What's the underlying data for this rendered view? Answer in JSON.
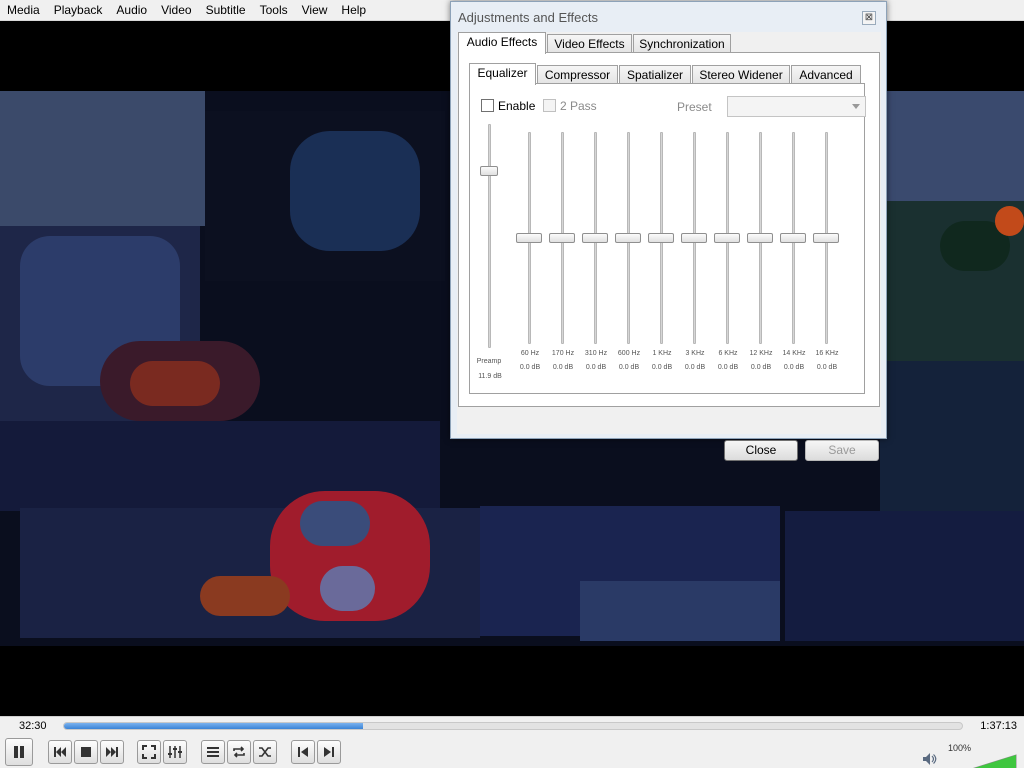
{
  "menubar": {
    "items": [
      "Media",
      "Playback",
      "Audio",
      "Video",
      "Subtitle",
      "Tools",
      "View",
      "Help"
    ]
  },
  "player": {
    "time_elapsed": "32:30",
    "time_total": "1:37:13",
    "progress_fraction": 0.333,
    "volume_label": "100%",
    "volume_fraction": 1.0,
    "accent_color": "#3a83d6"
  },
  "dialog": {
    "title": "Adjustments and Effects",
    "close_glyph": "⊠",
    "top_tabs": [
      "Audio Effects",
      "Video Effects",
      "Synchronization"
    ],
    "active_top_tab": "Audio Effects",
    "sub_tabs": [
      "Equalizer",
      "Compressor",
      "Spatializer",
      "Stereo Widener",
      "Advanced"
    ],
    "active_sub_tab": "Equalizer",
    "enable_label": "Enable",
    "enable_checked": false,
    "twopass_label": "2 Pass",
    "preset_label": "Preset",
    "preset_value": "",
    "preamp": {
      "name": "Preamp",
      "value": "11.9 dB",
      "level_fraction": 0.79
    },
    "bands": [
      {
        "freq": "60 Hz",
        "value": "0.0 dB",
        "level_fraction": 0.5
      },
      {
        "freq": "170 Hz",
        "value": "0.0 dB",
        "level_fraction": 0.5
      },
      {
        "freq": "310 Hz",
        "value": "0.0 dB",
        "level_fraction": 0.5
      },
      {
        "freq": "600 Hz",
        "value": "0.0 dB",
        "level_fraction": 0.5
      },
      {
        "freq": "1 KHz",
        "value": "0.0 dB",
        "level_fraction": 0.5
      },
      {
        "freq": "3 KHz",
        "value": "0.0 dB",
        "level_fraction": 0.5
      },
      {
        "freq": "6 KHz",
        "value": "0.0 dB",
        "level_fraction": 0.5
      },
      {
        "freq": "12 KHz",
        "value": "0.0 dB",
        "level_fraction": 0.5
      },
      {
        "freq": "14 KHz",
        "value": "0.0 dB",
        "level_fraction": 0.5
      },
      {
        "freq": "16 KHz",
        "value": "0.0 dB",
        "level_fraction": 0.5
      }
    ],
    "close_button": "Close",
    "save_button": "Save"
  },
  "icons": {
    "play_pause": "pause-icon",
    "prev": "skip-back-icon",
    "stop": "stop-icon",
    "next": "skip-forward-icon",
    "fullscreen": "fullscreen-icon",
    "extended": "equalizer-sliders-icon",
    "playlist": "playlist-icon",
    "loop": "loop-icon",
    "random": "shuffle-icon",
    "frame_prev": "frame-back-icon",
    "frame_next": "frame-forward-icon",
    "volume": "speaker-icon"
  }
}
